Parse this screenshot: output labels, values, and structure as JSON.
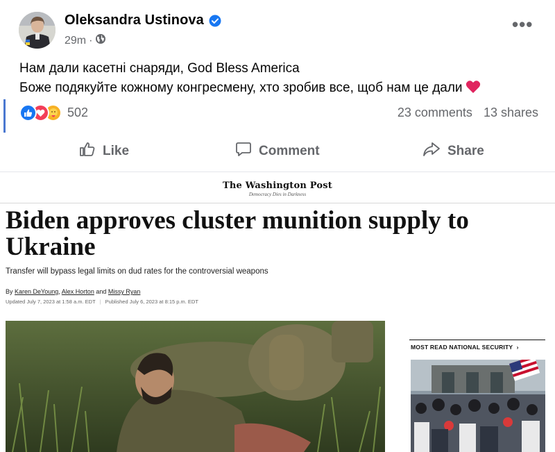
{
  "facebook_post": {
    "author": "Oleksandra Ustinova",
    "time": "29m",
    "visibility_icon": "globe-icon",
    "lines": [
      "Нам дали касетні снаряди, God Bless America",
      "Боже подякуйте кожному конгресмену, хто зробив все, щоб нам це дали"
    ],
    "reaction_icons": [
      "like-reaction-icon",
      "love-reaction-icon",
      "care-reaction-icon"
    ],
    "reaction_count": "502",
    "comments": "23 comments",
    "shares": "13 shares",
    "actions": {
      "like": "Like",
      "comment": "Comment",
      "share": "Share"
    },
    "colors": {
      "verified": "#1877f2",
      "like": "#1877f2",
      "love": "#f33e58",
      "care": "#f7b125",
      "heart": "#e0245e"
    }
  },
  "article": {
    "masthead": "The Washington Post",
    "tagline": "Democracy Dies in Darkness",
    "headline": "Biden approves cluster munition supply to Ukraine",
    "dek": "Transfer will bypass legal limits on dud rates for the controversial weapons",
    "byline": {
      "prefix": "By",
      "authors": [
        "Karen DeYoung",
        "Alex Horton",
        "Missy Ryan"
      ],
      "sep1": ",",
      "and": "and"
    },
    "updated": "Updated July 7, 2023 at 1:58 a.m. EDT",
    "published": "Published July 6, 2023 at 8:15 p.m. EDT",
    "sidebar_heading": "MOST READ NATIONAL SECURITY"
  }
}
